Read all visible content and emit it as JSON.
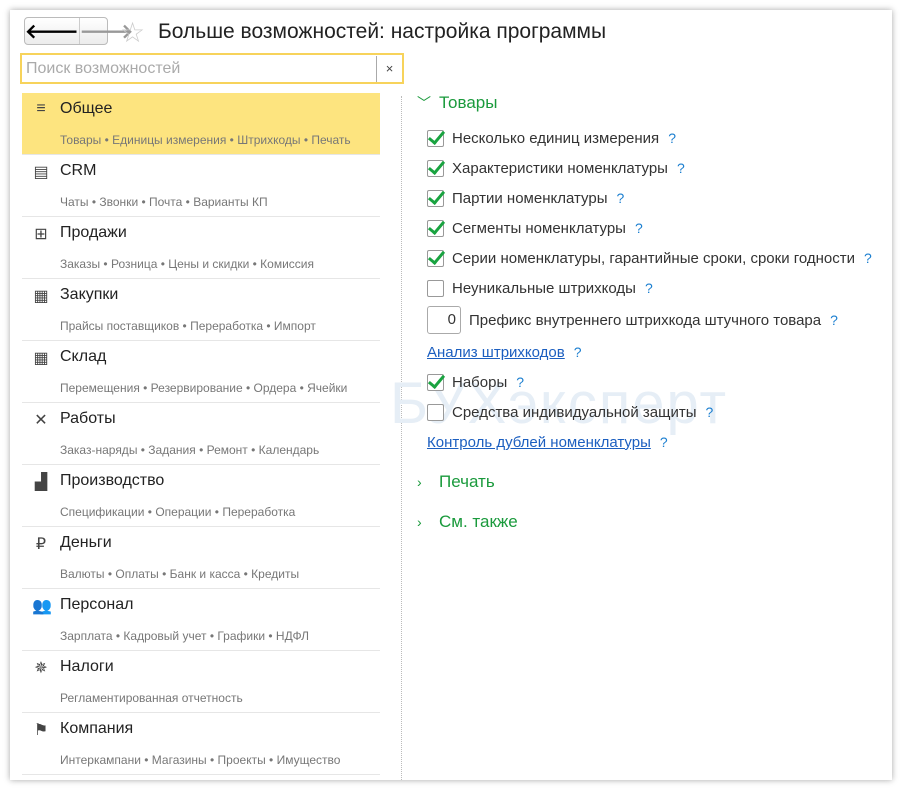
{
  "window": {
    "title": "Больше возможностей: настройка программы",
    "back": "🡐",
    "forward": "🡒",
    "star": "☆"
  },
  "search": {
    "placeholder": "Поиск возможностей",
    "value": "",
    "clear": "×"
  },
  "watermark": "БУХэксперт",
  "sections": [
    {
      "icon": "≡",
      "name": "Общее",
      "sub": "Товары • Единицы измерения • Штрихкоды • Печать",
      "selected": true
    },
    {
      "icon": "▤",
      "name": "CRM",
      "sub": "Чаты • Звонки • Почта • Варианты КП"
    },
    {
      "icon": "⊞",
      "name": "Продажи",
      "sub": "Заказы • Розница • Цены и скидки • Комиссия"
    },
    {
      "icon": "▦",
      "name": "Закупки",
      "sub": "Прайсы поставщиков • Переработка • Импорт"
    },
    {
      "icon": "▦",
      "name": "Склад",
      "sub": "Перемещения • Резервирование • Ордера • Ячейки"
    },
    {
      "icon": "✕",
      "name": "Работы",
      "sub": "Заказ-наряды • Задания • Ремонт • Календарь"
    },
    {
      "icon": "▟",
      "name": "Производство",
      "sub": "Спецификации • Операции • Переработка"
    },
    {
      "icon": "₽",
      "name": "Деньги",
      "sub": "Валюты • Оплаты • Банк и касса • Кредиты"
    },
    {
      "icon": "👥",
      "name": "Персонал",
      "sub": "Зарплата • Кадровый учет • Графики • НДФЛ"
    },
    {
      "icon": "✵",
      "name": "Налоги",
      "sub": "Регламентированная отчетность"
    },
    {
      "icon": "⚑",
      "name": "Компания",
      "sub": "Интеркампани • Магазины • Проекты • Имущество"
    }
  ],
  "goods": {
    "title": "Товары",
    "help": "?",
    "options": [
      {
        "label": "Несколько единиц измерения",
        "checked": true
      },
      {
        "label": "Характеристики номенклатуры",
        "checked": true
      },
      {
        "label": "Партии номенклатуры",
        "checked": true
      },
      {
        "label": "Сегменты номенклатуры",
        "checked": true
      },
      {
        "label": "Серии номенклатуры, гарантийные сроки, сроки годности",
        "checked": true
      },
      {
        "label": "Неуникальные штрихкоды",
        "checked": false
      }
    ],
    "prefix": {
      "value": "0",
      "label": "Префикс внутреннего штрихкода штучного товара"
    },
    "link1": "Анализ штрихкодов",
    "options2": [
      {
        "label": "Наборы",
        "checked": true
      },
      {
        "label": "Средства индивидуальной защиты",
        "checked": false
      }
    ],
    "link2": "Контроль дублей номенклатуры"
  },
  "print": {
    "title": "Печать"
  },
  "see_also": {
    "title": "См. также"
  }
}
